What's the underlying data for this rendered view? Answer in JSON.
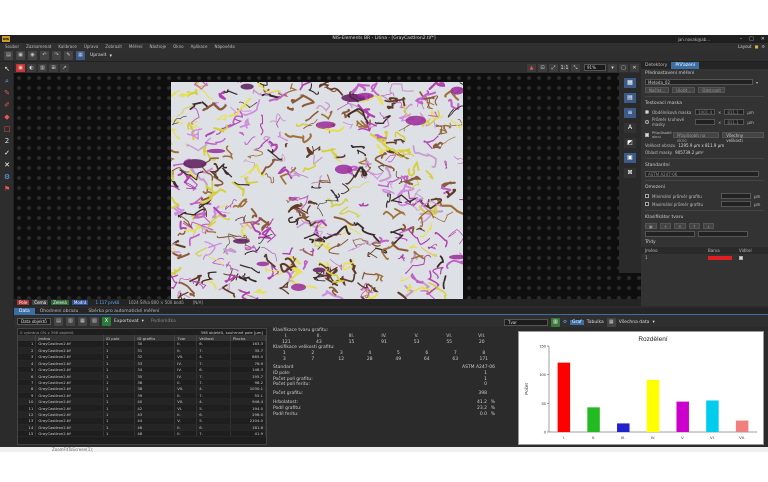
{
  "window": {
    "app_name": "NIS-Elements BR",
    "title": "NIS-Elements BR - Litina - [GrayCastIron2.tif*]",
    "user": "jan.novak@ab...",
    "logo": "NIS"
  },
  "menu": {
    "items": [
      "Soubor",
      "Zaznamenat",
      "Kalibrace",
      "Úprava",
      "Zobrazit",
      "Měření",
      "Nástroje",
      "Okno",
      "Aplikace",
      "Nápověda"
    ],
    "right_label": "Layout"
  },
  "toolbar": {
    "layout_label": "Upravit"
  },
  "image_tools": {
    "zoom": "91%"
  },
  "image_status": {
    "channels": [
      "Pole",
      "Černá",
      "Zelená",
      "Modrá"
    ],
    "channel_colors": [
      "#e04040",
      "#444444",
      "#3aa04a",
      "#3a6fd8"
    ],
    "selected_count": "1 117 prvků",
    "dimensions": "1024 Šířka 800 × 500 bodů",
    "mode": "[N/A]"
  },
  "right_panel": {
    "tabs": [
      "Detektory",
      "Přiřazení"
    ],
    "active_tab": "Přiřazení",
    "preset_section": "Přednastavení měření",
    "preset_value": "Metoda_02",
    "preset_buttons": [
      "Načíst...",
      "Uložit...",
      "Odstranit"
    ],
    "mask_section": "Testovací maska",
    "mask_options": [
      {
        "label": "Obdélníková maska",
        "value1": "1001.4",
        "value2": "811.1",
        "unit": "μm"
      },
      {
        "label": "Průměr kruhové masky",
        "value1": "",
        "value2": "811.1",
        "unit": "μm"
      }
    ],
    "fill_label": "Přizpůsobit oknu",
    "fill_button": "Přizpůsobit na okno",
    "full_button": "Všechny velikosti",
    "size_label": "Velikost obrazu",
    "size_value": "1295.9 μm x 811.9 μm",
    "area_label": "Oblast masky",
    "area_value": "905739.2 μm²",
    "standard_section": "Standardní",
    "standard_value": "ASTM A247-06",
    "limits_section": "Omezení",
    "limit_min": "Minimální průměr grafitu",
    "limit_max": "Maximální průměr grafitu",
    "limit_unit": "μm",
    "classifier_section": "Klasifikátor tvaru",
    "classes_section": "Třídy",
    "class_col_name": "Jméno",
    "class_col_color": "Barva",
    "class_col_vis": "Viditel",
    "class_row_index": "1"
  },
  "data_panel": {
    "tabs": [
      "Data",
      "Ohodnení obrazu",
      "Sběrka pro automatické měření"
    ],
    "active_tab": "Data",
    "select_label": "Data objektů",
    "export_label": "Exportovat",
    "extra_label": "Podlomítka",
    "table_info": "0 vybráno 0% z 398 objektů. ",
    "table_total": "398 objektů, souhrnné pole [μm]",
    "columns": [
      "",
      "Jméno",
      "ID pole",
      "ID grafitu",
      "Tvar",
      "Velikost",
      "Plocha"
    ],
    "rows": [
      [
        "1",
        "GrayCastIron2.tif",
        "1",
        "30",
        "II.",
        "6.",
        "163.3"
      ],
      [
        "2",
        "GrayCastIron2.tif",
        "1",
        "31",
        "II.",
        "7.",
        "35.7"
      ],
      [
        "3",
        "GrayCastIron2.tif",
        "1",
        "32",
        "VII.",
        "4.",
        "865.0"
      ],
      [
        "4",
        "GrayCastIron2.tif",
        "1",
        "33",
        "IV.",
        "7.",
        "76.9"
      ],
      [
        "5",
        "GrayCastIron2.tif",
        "1",
        "34",
        "IV.",
        "6.",
        "148.3"
      ],
      [
        "6",
        "GrayCastIron2.tif",
        "1",
        "35",
        "IV.",
        "7.",
        "195.7"
      ],
      [
        "7",
        "GrayCastIron2.tif",
        "1",
        "36",
        "II.",
        "7.",
        "98.2"
      ],
      [
        "8",
        "GrayCastIron2.tif",
        "1",
        "38",
        "VII.",
        "4.",
        "1030.1"
      ],
      [
        "9",
        "GrayCastIron2.tif",
        "1",
        "39",
        "II.",
        "7.",
        "55.1"
      ],
      [
        "10",
        "GrayCastIron2.tif",
        "1",
        "40",
        "VII.",
        "4.",
        "946.4"
      ],
      [
        "11",
        "GrayCastIron2.tif",
        "1",
        "42",
        "VI.",
        "5.",
        "194.0"
      ],
      [
        "12",
        "GrayCastIron2.tif",
        "1",
        "43",
        "II.",
        "6.",
        "298.0"
      ],
      [
        "13",
        "GrayCastIron2.tif",
        "1",
        "44",
        "V.",
        "5.",
        "2104.0"
      ],
      [
        "14",
        "GrayCastIron2.tif",
        "1",
        "46",
        "II.",
        "6.",
        "181.6"
      ],
      [
        "15",
        "GrayCastIron2.tif",
        "1",
        "48",
        "II.",
        "7.",
        "41.9"
      ]
    ]
  },
  "classification": {
    "shape_title": "Klasifikace tvaru grafitu:",
    "shape_classes": [
      "I.",
      "II.",
      "III.",
      "IV.",
      "V.",
      "VI.",
      "VII."
    ],
    "shape_counts": [
      "121",
      "43",
      "15",
      "91",
      "53",
      "55",
      "20"
    ],
    "size_title": "Klasifikace velikosti grafitu:",
    "size_classes": [
      "1",
      "2",
      "3",
      "4",
      "5",
      "6",
      "7",
      "8"
    ],
    "size_counts": [
      "3",
      "7",
      "12",
      "28",
      "49",
      "64",
      "63",
      "171"
    ],
    "standard_label": "Standard",
    "standard_value": "ASTM A247-06",
    "fields": [
      {
        "label": "ID pole:",
        "value": "1",
        "unit": ""
      },
      {
        "label": "Počet polí grafitu:",
        "value": "1",
        "unit": ""
      },
      {
        "label": "Počet polí feritu:",
        "value": "0",
        "unit": ""
      }
    ],
    "fields2": [
      {
        "label": "Počet grafitu:",
        "value": "398",
        "unit": ""
      }
    ],
    "fields3": [
      {
        "label": "Hrbolatost:",
        "value": "41.2",
        "unit": "%"
      },
      {
        "label": "Podíl grafitu:",
        "value": "23.2",
        "unit": "%"
      },
      {
        "label": "Podíl feritu:",
        "value": "0.0",
        "unit": "%"
      }
    ]
  },
  "graph_panel": {
    "select": "Tvar",
    "graph_label": "Graf",
    "table_label": "Tabulka",
    "export_label": "Všechna data"
  },
  "chart_data": {
    "type": "bar",
    "title": "Rozdělení",
    "categories": [
      "I.",
      "II.",
      "III.",
      "IV.",
      "V.",
      "VI.",
      "VII."
    ],
    "values": [
      121,
      43,
      15,
      91,
      53,
      55,
      20
    ],
    "colors": [
      "#ff0000",
      "#22bb22",
      "#2222cc",
      "#ffff00",
      "#cc00cc",
      "#00ccee",
      "#f08080"
    ],
    "ylabel": "Počet",
    "xlabel": "",
    "ylim": [
      0,
      150
    ],
    "yticks": [
      0,
      50,
      100,
      150
    ],
    "grid": false,
    "legend": "none"
  },
  "statusbar": {
    "text": "ZoomFitToScreen(1);"
  }
}
